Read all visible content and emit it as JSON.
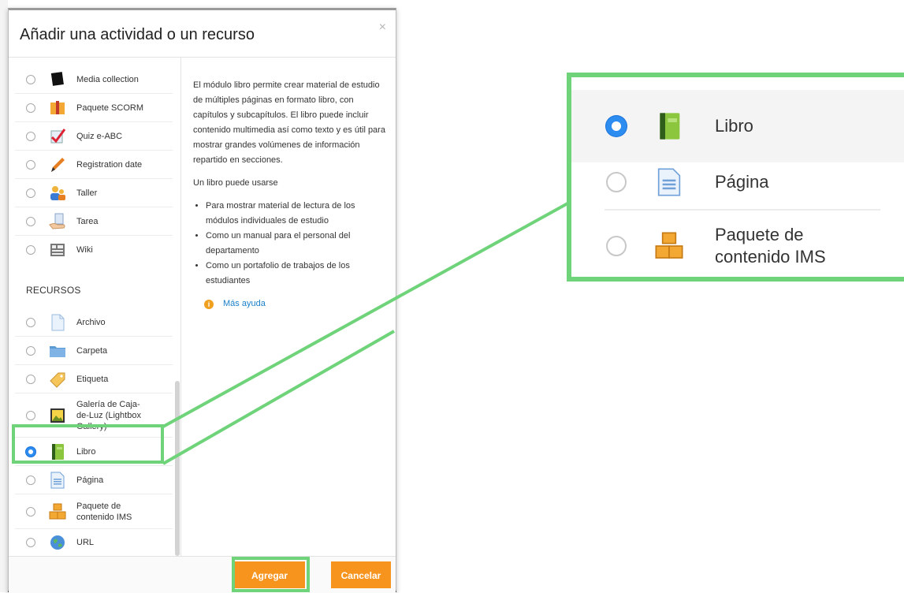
{
  "dialog": {
    "title": "Añadir una actividad o un recurso",
    "close_symbol": "×",
    "section_resources": "RECURSOS",
    "activities": [
      {
        "label": "Media collection",
        "icon": "media-collection-icon"
      },
      {
        "label": "Paquete SCORM",
        "icon": "scorm-package-icon"
      },
      {
        "label": "Quiz e-ABC",
        "icon": "quiz-check-icon"
      },
      {
        "label": "Registration date",
        "icon": "pen-icon"
      },
      {
        "label": "Taller",
        "icon": "workshop-people-icon"
      },
      {
        "label": "Tarea",
        "icon": "assignment-hand-icon"
      },
      {
        "label": "Wiki",
        "icon": "wiki-icon"
      }
    ],
    "resources": [
      {
        "label": "Archivo",
        "icon": "file-icon"
      },
      {
        "label": "Carpeta",
        "icon": "folder-icon"
      },
      {
        "label": "Etiqueta",
        "icon": "label-tag-icon"
      },
      {
        "label": "Galería de Caja-de-Luz (Lightbox Gallery)",
        "icon": "gallery-icon"
      },
      {
        "label": "Libro",
        "icon": "book-icon",
        "selected": true
      },
      {
        "label": "Página",
        "icon": "page-icon"
      },
      {
        "label": "Paquete de contenido IMS",
        "icon": "ims-package-icon"
      },
      {
        "label": "URL",
        "icon": "url-globe-icon"
      }
    ],
    "description": {
      "para1": "El módulo libro permite crear material de estudio de múltiples páginas en formato libro, con capítulos y subcapítulos. El libro puede incluir contenido multimedia así como texto y es útil para mostrar grandes volúmenes de información repartido en secciones.",
      "para2": "Un libro puede usarse",
      "bullets": [
        "Para mostrar material de lectura de los módulos individuales de estudio",
        "Como un manual para el personal del departamento",
        "Como un portafolio de trabajos de los estudiantes"
      ],
      "help_link": "Más ayuda"
    },
    "buttons": {
      "add": "Agregar",
      "cancel": "Cancelar"
    }
  },
  "zoom": {
    "items": [
      {
        "label": "Libro",
        "selected": true
      },
      {
        "label": "Página"
      },
      {
        "label": "Paquete de contenido IMS"
      }
    ]
  },
  "colors": {
    "accent_orange": "#f7941d",
    "highlight_green": "#6fd37a",
    "radio_blue": "#2d8cf0"
  }
}
